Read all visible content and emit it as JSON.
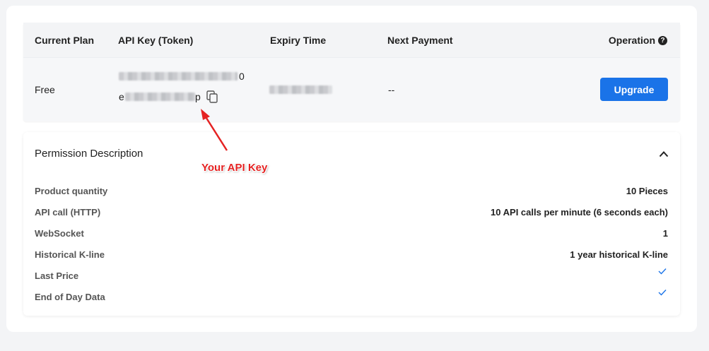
{
  "table": {
    "headers": {
      "current_plan": "Current Plan",
      "api_key": "API Key (Token)",
      "expiry_time": "Expiry Time",
      "next_payment": "Next Payment",
      "operation": "Operation"
    },
    "help_icon_glyph": "?",
    "row": {
      "plan": "Free",
      "api_key_line1_suffix": "0",
      "api_key_line2_prefix": "e",
      "api_key_line2_suffix": "p",
      "next_payment": "--",
      "upgrade_label": "Upgrade"
    }
  },
  "permissions": {
    "title": "Permission Description",
    "items": [
      {
        "label": "Product quantity",
        "value": "10 Pieces"
      },
      {
        "label": "API call (HTTP)",
        "value": "10 API calls per minute (6 seconds each)"
      },
      {
        "label": "WebSocket",
        "value": "1"
      },
      {
        "label": "Historical K-line",
        "value": "1 year historical K-line"
      },
      {
        "label": "Last Price",
        "value": "check-icon"
      },
      {
        "label": "End of Day Data",
        "value": "check-icon"
      }
    ]
  },
  "annotation": {
    "text": "Your API Key"
  },
  "icons": {
    "copy": "copy-icon",
    "help": "help-icon",
    "collapse": "chevron-up-icon",
    "check": "check-icon"
  },
  "colors": {
    "accent": "#1a73e8",
    "annotation": "#e52222",
    "check": "#1a73e8"
  }
}
